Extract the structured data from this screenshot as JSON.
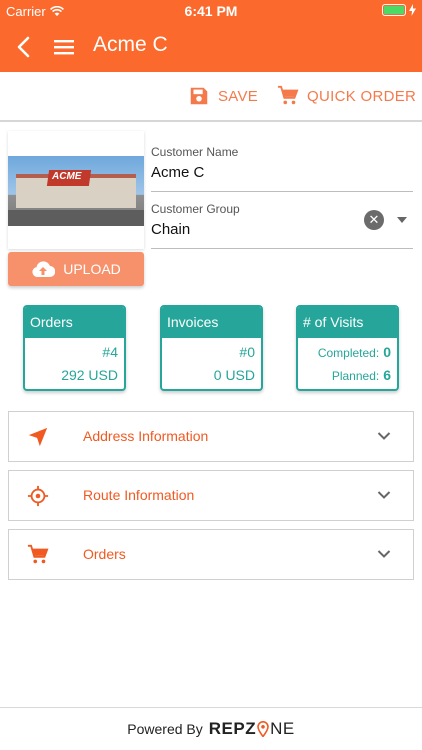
{
  "status_bar": {
    "carrier": "Carrier",
    "time": "6:41 PM"
  },
  "app_bar": {
    "title": "Acme C"
  },
  "toolbar": {
    "save_label": "SAVE",
    "quick_order_label": "QUICK ORDER"
  },
  "customer": {
    "upload_label": "UPLOAD",
    "photo_logo_text": "ACME",
    "name_label": "Customer Name",
    "name_value": "Acme C",
    "group_label": "Customer Group",
    "group_value": "Chain"
  },
  "stats": {
    "orders": {
      "title": "Orders",
      "count": "#4",
      "amount": "292 USD"
    },
    "invoices": {
      "title": "Invoices",
      "count": "#0",
      "amount": "0 USD"
    },
    "visits": {
      "title": "# of Visits",
      "completed_label": "Completed:",
      "completed_value": "0",
      "planned_label": "Planned:",
      "planned_value": "6"
    }
  },
  "sections": [
    {
      "label": "Address Information",
      "icon": "navigation-arrow-icon"
    },
    {
      "label": "Route Information",
      "icon": "crosshair-icon"
    },
    {
      "label": "Orders",
      "icon": "cart-icon"
    }
  ],
  "footer": {
    "powered_by": "Powered By",
    "brand_part1": "REP",
    "brand_part2": "Z",
    "brand_part3": "NE"
  },
  "colors": {
    "primary": "#fb6a2c",
    "accent": "#f47a4c",
    "teal": "#26a69a"
  }
}
